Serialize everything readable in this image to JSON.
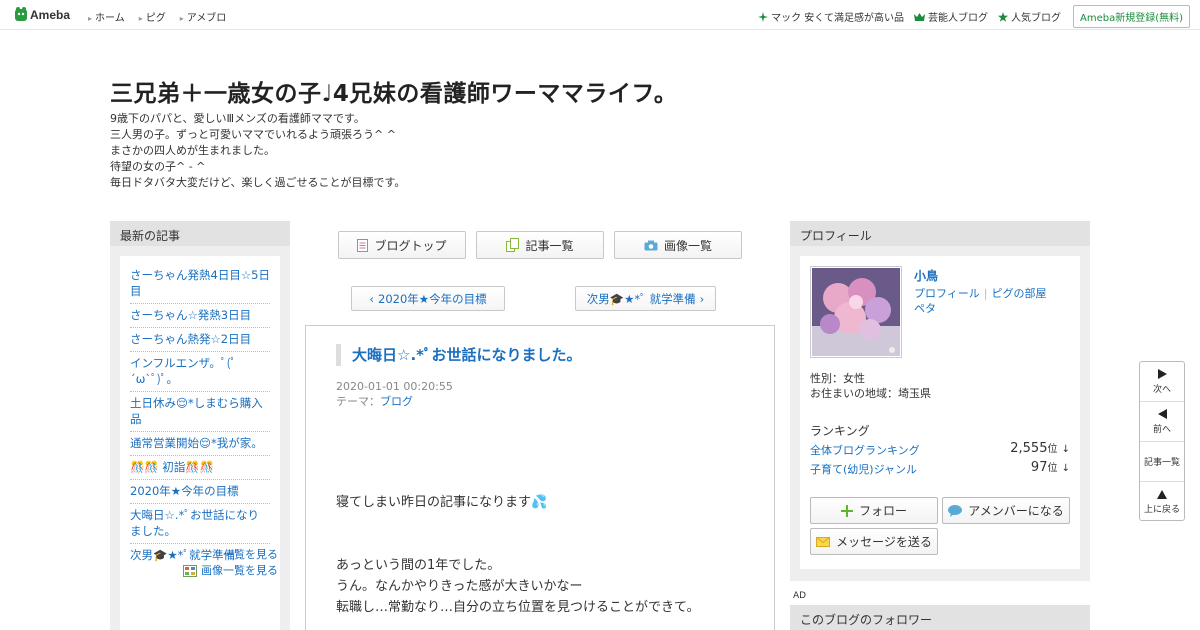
{
  "topbar": {
    "logo_text": "Ameba",
    "nav": [
      "ホーム",
      "ピグ",
      "アメブロ"
    ],
    "right_links": [
      {
        "label": "マック 安くて満足感が高い品",
        "icon": "sparkle-icon"
      },
      {
        "label": "芸能人ブログ",
        "icon": "crown-icon"
      },
      {
        "label": "人気ブログ",
        "icon": "star-icon"
      }
    ],
    "register_label": "Ameba新規登録(無料)"
  },
  "blog": {
    "title": "三兄弟＋一歳女の子♩4兄妹の看護師ワーママライフ。",
    "description": [
      "9歳下のパパと、愛しいⅢメンズの看護師ママです。",
      "三人男の子。ずっと可愛いママでいれるよう頑張ろう^ ^",
      "まさかの四人めが生まれました。",
      "待望の女の子^ - ^",
      "毎日ドタバタ大変だけど、楽しく過ごせることが目標です。"
    ]
  },
  "left": {
    "heading": "最新の記事",
    "entries": [
      "さーちゃん発熱4日目☆5日目",
      "さーちゃん☆発熱3日目",
      "さーちゃん熱発☆2日目",
      "インフルエンザ。ﾟ(ﾟ´ω`ﾟ)ﾟ。",
      "土日休み😌*しまむら購入品",
      "通常営業開始😌*我が家。",
      "🎊🎊 初詣🎊🎊",
      "2020年★今年の目標",
      "大晦日☆.*ﾟお世話になりました。",
      "次男🎓★*ﾟ就学準備"
    ],
    "more_label": "一覧を見る",
    "images_label": "画像一覧を見る"
  },
  "center": {
    "buttons": [
      {
        "label": "ブログトップ",
        "icon": "document-icon"
      },
      {
        "label": "記事一覧",
        "icon": "copy-icon"
      },
      {
        "label": "画像一覧",
        "icon": "camera-icon"
      }
    ],
    "prev_label": "2020年★今年の目標",
    "next_label": "次男🎓★*ﾟ 就学準備",
    "article": {
      "title": "大晦日☆.*ﾟお世話になりました。",
      "date": "2020-01-01 00:20:55",
      "theme_prefix": "テーマ：",
      "theme": "ブログ",
      "body": [
        "寝てしまい昨日の記事になります💦",
        "あっという間の1年でした。",
        "うん。なんかやりきった感が大きいかなー",
        "転職し…常勤なり…自分の立ち位置を見つけることができて。"
      ]
    }
  },
  "profile": {
    "heading": "プロフィール",
    "name": "小鳥",
    "link_profile": "プロフィール",
    "link_pig": "ピグの部屋",
    "link_peta": "ペタ",
    "gender": "性別：女性",
    "area": "お住まいの地域：埼玉県",
    "ranking_title": "ランキング",
    "rankings": [
      {
        "label": "全体ブログランキング",
        "value": "2,555",
        "unit": "位",
        "trend": "↓"
      },
      {
        "label": "子育て(幼児)ジャンル",
        "value": "97",
        "unit": "位",
        "trend": "↓"
      }
    ],
    "follow_label": "フォロー",
    "amember_label": "アメンバーになる",
    "message_label": "メッセージを送る"
  },
  "ad_label": "AD",
  "followers_heading": "このブログのフォロワー",
  "sidenav": {
    "next": "次へ",
    "prev": "前へ",
    "list": "記事一覧",
    "top": "上に戻る"
  },
  "colors": {
    "link": "#1a6fc0",
    "green": "#1c8c3c",
    "panel": "#eeeeee"
  }
}
